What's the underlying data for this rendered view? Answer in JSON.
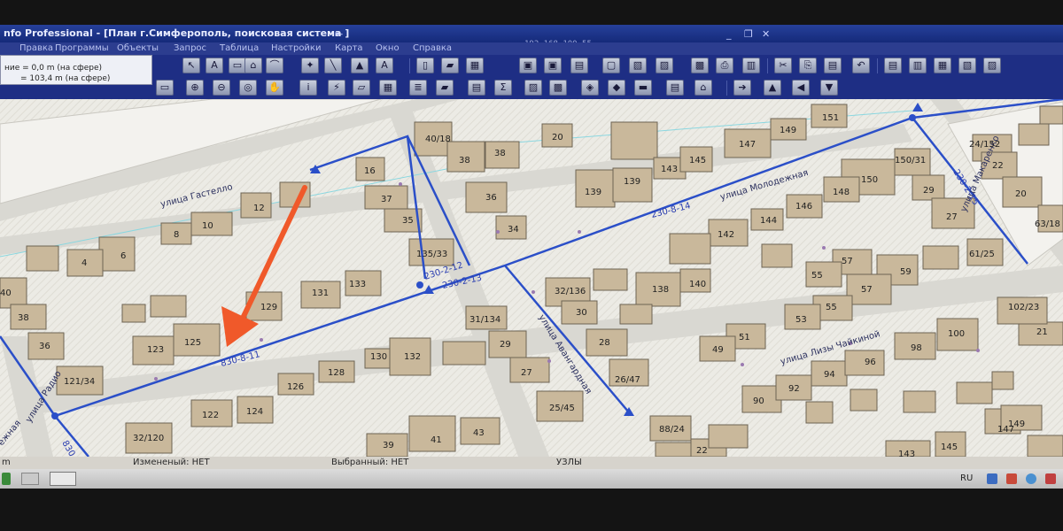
{
  "window": {
    "title": "nfo Professional - [План г.Симферополь, поисковая система ]",
    "remote_ip": "192.168.100.55"
  },
  "menu": {
    "items": [
      "Правка",
      "Программы",
      "Объекты",
      "Запрос",
      "Таблица",
      "Настройки",
      "Карта",
      "Окно",
      "Справка"
    ]
  },
  "measure_box": {
    "line1": "ние   = 0,0 m (на сфере)",
    "line2": "= 103,4 m (на сфере)"
  },
  "map": {
    "streets": [
      "улица Гастелло",
      "улица Молодежная",
      "улица Авангардная",
      "улица Лизы Чайкиной",
      "улица Макаренко",
      "улица Радио",
      "ежная"
    ],
    "route_labels": [
      "830-8-11",
      "230-2-13",
      "230-2-12",
      "230-8-14",
      "230-2-15",
      "830"
    ],
    "house_numbers": [
      "40/18",
      "20",
      "38",
      "38",
      "16",
      "37",
      "36",
      "35",
      "34",
      "135/33",
      "12",
      "10",
      "8",
      "6",
      "4",
      "40",
      "38",
      "36",
      "121/34",
      "131",
      "133",
      "129",
      "123",
      "125",
      "130",
      "132",
      "128",
      "126",
      "124",
      "122",
      "32/120",
      "31/134",
      "29",
      "27",
      "25/45",
      "41",
      "43",
      "39",
      "32/136",
      "30",
      "28",
      "26/47",
      "88/24",
      "22",
      "139",
      "139",
      "143",
      "145",
      "147",
      "149",
      "151",
      "150/31",
      "150",
      "148",
      "29",
      "146",
      "144",
      "142",
      "27",
      "57",
      "55",
      "59",
      "61/25",
      "57",
      "55",
      "53",
      "51",
      "49",
      "138",
      "140",
      "92",
      "94",
      "96",
      "98",
      "100",
      "90",
      "102/23",
      "21",
      "147",
      "149",
      "143",
      "145",
      "24/152",
      "22",
      "20",
      "63/18"
    ],
    "arrow_color": "#f0592a",
    "route_color": "#2b4fc8"
  },
  "status": {
    "changed": "Измененый: НЕТ",
    "selected": "Выбранный: НЕТ",
    "nodes": "УЗЛЫ",
    "left_fragment": "m"
  },
  "taskbar": {
    "language": "RU"
  }
}
